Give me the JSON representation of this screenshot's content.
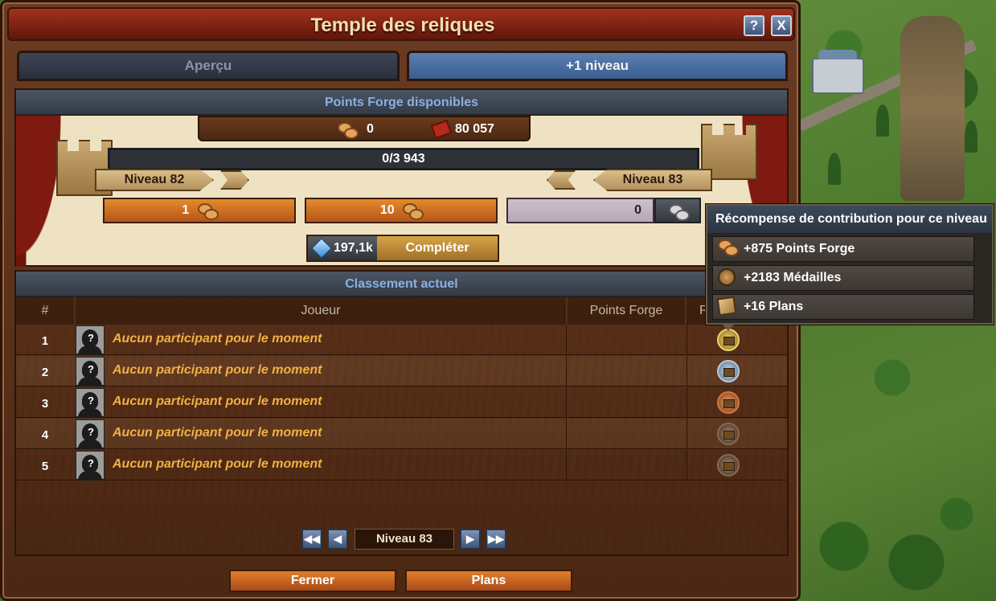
{
  "window": {
    "title": "Temple des reliques",
    "help_label": "?",
    "close_label": "X"
  },
  "tabs": [
    {
      "label": "Aperçu",
      "active": false
    },
    {
      "label": "+1 niveau",
      "active": true
    }
  ],
  "forge_points": {
    "header": "Points Forge disponibles",
    "available_fp": "0",
    "goods_count": "80 057",
    "progress_text": "0/3 943",
    "progress_fraction": 0,
    "current_level": "Niveau 82",
    "next_level": "Niveau 83",
    "buttons": [
      {
        "label": "1"
      },
      {
        "label": "10"
      }
    ],
    "custom_amount": "0",
    "diamond_cost": "197,1k",
    "complete_label": "Compléter"
  },
  "ranking": {
    "header": "Classement actuel",
    "columns": {
      "rank": "#",
      "player": "Joueur",
      "points": "Points Forge",
      "reward": "R"
    },
    "rows": [
      {
        "rank": "1",
        "player": "Aucun participant pour le moment",
        "points": "",
        "chest": "gold"
      },
      {
        "rank": "2",
        "player": "Aucun participant pour le moment",
        "points": "",
        "chest": "silver"
      },
      {
        "rank": "3",
        "player": "Aucun participant pour le moment",
        "points": "",
        "chest": "bronze"
      },
      {
        "rank": "4",
        "player": "Aucun participant pour le moment",
        "points": "",
        "chest": "dark"
      },
      {
        "rank": "5",
        "player": "Aucun participant pour le moment",
        "points": "",
        "chest": "dark"
      }
    ],
    "avatar_placeholder": "?"
  },
  "pagination": {
    "first_label": "◀◀",
    "prev_label": "◀",
    "current": "Niveau 83",
    "next_label": "▶",
    "last_label": "▶▶"
  },
  "footer": {
    "close_label": "Fermer",
    "plans_label": "Plans"
  },
  "tooltip": {
    "title": "Récompense de contribution pour ce niveau",
    "rewards": [
      {
        "text": "+875 Points Forge",
        "icon": "forge-points-icon"
      },
      {
        "text": "+2183 Médailles",
        "icon": "medal-icon"
      },
      {
        "text": "+16 Plans",
        "icon": "blueprint-icon"
      }
    ]
  }
}
